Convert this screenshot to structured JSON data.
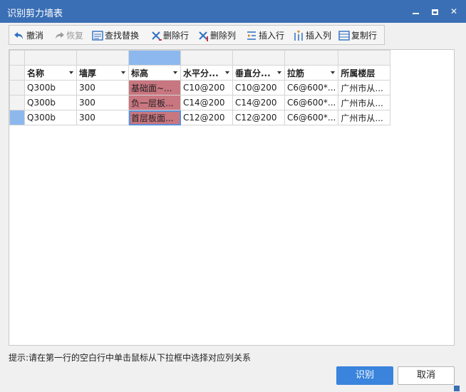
{
  "window": {
    "title": "识别剪力墙表"
  },
  "toolbar": {
    "undo": "撤消",
    "redo": "恢复",
    "find_replace": "查找替换",
    "delete_row": "删除行",
    "delete_col": "删除列",
    "insert_row": "插入行",
    "insert_col": "插入列",
    "copy_row": "复制行"
  },
  "grid": {
    "columns": [
      "名称",
      "墙厚",
      "标高",
      "水平分...",
      "垂直分...",
      "拉筋",
      "所属楼层"
    ],
    "rows": [
      [
        "Q300b",
        "300",
        "基础面~...",
        "C10@200",
        "C10@200",
        "C6@600*...",
        "广州市从..."
      ],
      [
        "Q300b",
        "300",
        "负一层板...",
        "C14@200",
        "C14@200",
        "C6@600*...",
        "广州市从..."
      ],
      [
        "Q300b",
        "300",
        "首层板面...",
        "C12@200",
        "C12@200",
        "C6@600*...",
        "广州市从..."
      ]
    ]
  },
  "hint": "提示:请在第一行的空白行中单击鼠标从下拉框中选择对应列关系",
  "buttons": {
    "recognize": "识别",
    "cancel": "取消"
  },
  "colors": {
    "titlebar": "#3a6fb5",
    "highlight_cell": "#c87680",
    "selected_column": "#8db8ee",
    "primary_button": "#3a84dd"
  }
}
